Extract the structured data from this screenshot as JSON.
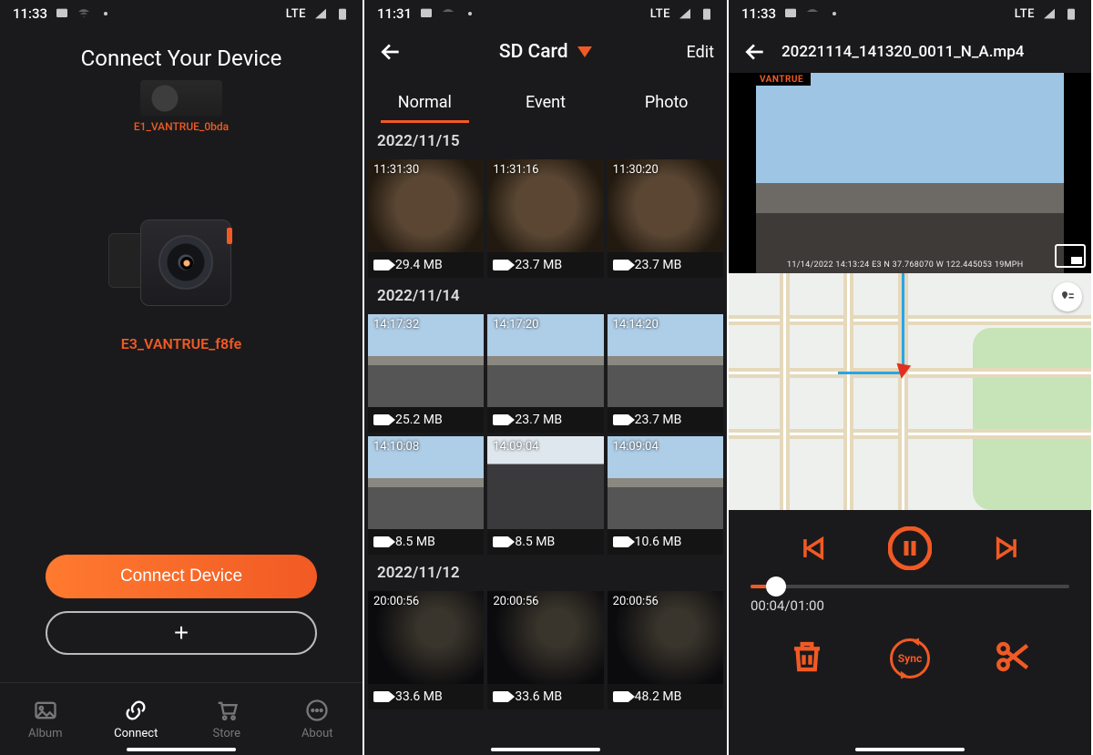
{
  "status": {
    "p1_time": "11:33",
    "p2_time": "11:31",
    "p3_time": "11:33",
    "net": "LTE"
  },
  "p1": {
    "title": "Connect Your Device",
    "prior_device": "E1_VANTRUE_0bda",
    "device_name": "E3_VANTRUE_f8fe",
    "connect_label": "Connect Device",
    "add_label": "+",
    "nav": {
      "album": "Album",
      "connect": "Connect",
      "store": "Store",
      "about": "About"
    }
  },
  "p2": {
    "title": "SD Card",
    "edit": "Edit",
    "tabs": {
      "normal": "Normal",
      "event": "Event",
      "photo": "Photo"
    },
    "groups": [
      {
        "date": "2022/11/15",
        "items": [
          {
            "time": "11:31:30",
            "size": "29.4 MB"
          },
          {
            "time": "11:31:16",
            "size": "23.7 MB"
          },
          {
            "time": "11:30:20",
            "size": "23.7 MB"
          }
        ]
      },
      {
        "date": "2022/11/14",
        "items": [
          {
            "time": "14:17:32",
            "size": "25.2 MB"
          },
          {
            "time": "14:17:20",
            "size": "23.7 MB"
          },
          {
            "time": "14:14:20",
            "size": "23.7 MB"
          },
          {
            "time": "14:10:08",
            "size": "8.5 MB"
          },
          {
            "time": "14:09:04",
            "size": "8.5 MB"
          },
          {
            "time": "14:09:04",
            "size": "10.6 MB"
          }
        ]
      },
      {
        "date": "2022/11/12",
        "items": [
          {
            "time": "20:00:56",
            "size": "33.6 MB"
          },
          {
            "time": "20:00:56",
            "size": "33.6 MB"
          },
          {
            "time": "20:00:56",
            "size": "48.2 MB"
          }
        ]
      }
    ]
  },
  "p3": {
    "filename": "20221114_141320_0011_N_A.mp4",
    "watermark": "VANTRUE",
    "overlay": "11/14/2022  14:13:24 E3  N 37.768070  W 122.445053  19MPH",
    "time": "00:04/01:00",
    "sync": "Sync"
  }
}
